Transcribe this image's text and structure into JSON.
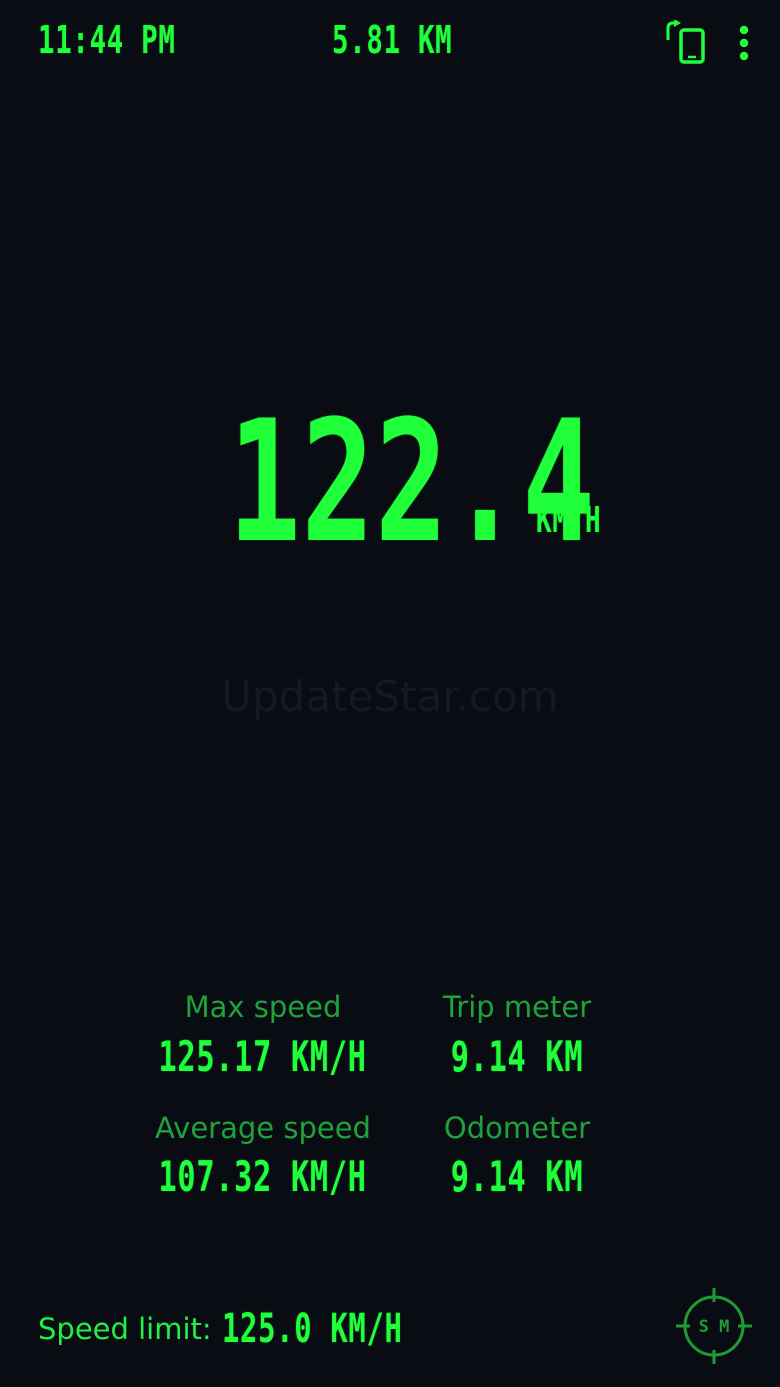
{
  "header": {
    "time": "11:44 PM",
    "distance": "5.81 KM",
    "rotate_icon": "rotate-screen-icon",
    "menu_icon": "more-vertical-icon"
  },
  "speed": {
    "value": "122.4",
    "unit": "KM/H"
  },
  "watermark": "UpdateStar.com",
  "stats": {
    "max_speed": {
      "label": "Max speed",
      "value": "125.17 KM/H"
    },
    "trip_meter": {
      "label": "Trip meter",
      "value": "9.14 KM"
    },
    "average_speed": {
      "label": "Average speed",
      "value": "107.32 KM/H"
    },
    "odometer": {
      "label": "Odometer",
      "value": "9.14 KM"
    }
  },
  "footer": {
    "speed_limit_label": "Speed limit:",
    "speed_limit_value": "125.0 KM/H",
    "mode_icon": "crosshair-mode-icon",
    "mode_text": "S M"
  },
  "colors": {
    "background": "#0a0c14",
    "lcd_green": "#1fff3a",
    "label_green": "#1fa23a",
    "watermark": "#161822"
  }
}
